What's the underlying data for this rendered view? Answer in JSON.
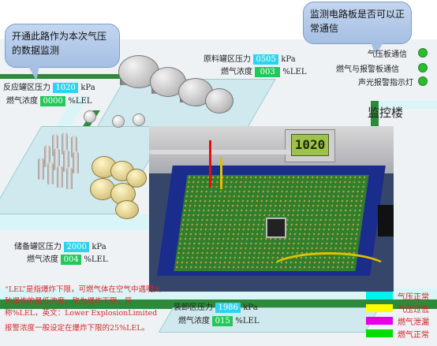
{
  "callouts": {
    "top_left": "开通此路作为本次气压的数据监测",
    "top_right": "监测电路板是否可以正常通信"
  },
  "readouts": {
    "raw_tank": {
      "pressure_label": "原料罐区压力",
      "pressure_value": "0505",
      "pressure_unit": "kPa",
      "gas_label": "燃气浓度",
      "gas_value": "003",
      "gas_unit": "%LEL"
    },
    "reaction_zone": {
      "pressure_label": "反应罐区压力",
      "pressure_value": "1020",
      "pressure_unit": "kPa",
      "gas_label": "燃气浓度",
      "gas_value": "0000",
      "gas_unit": "%LEL"
    },
    "storage_zone": {
      "pressure_label": "储备罐区压力",
      "pressure_value": "2000",
      "pressure_unit": "kPa",
      "gas_label": "燃气浓度",
      "gas_value": "004",
      "gas_unit": "%LEL"
    },
    "unload_zone": {
      "pressure_label": "装卸区压力",
      "pressure_value": "1986",
      "pressure_unit": "kPa",
      "gas_label": "燃气浓度",
      "gas_value": "015",
      "gas_unit": "%LEL"
    }
  },
  "status": {
    "items": [
      {
        "label": "气压板通信",
        "state": "ok"
      },
      {
        "label": "燃气与报警板通信",
        "state": "ok"
      },
      {
        "label": "声光报警指示灯",
        "state": "ok"
      }
    ],
    "color_ok": "#22c02a"
  },
  "building_title": "监控楼",
  "lcd_value": "1020",
  "note": {
    "line1": "“LEL”是指爆炸下限，可燃气体在空气中遇明火种爆炸的最低浓度，称为爆炸下限，简称%LEL，英文：Lower ExplosionLimited",
    "line2": "报警浓度一般设定在爆炸下限的25%LEL。"
  },
  "legend": [
    {
      "label": "气压正常",
      "color": "#00f0f0"
    },
    {
      "label": "气压过低",
      "color": "#ffff00"
    },
    {
      "label": "燃气泄漏",
      "color": "#e600e6"
    },
    {
      "label": "燃气正常",
      "color": "#00dd00"
    }
  ]
}
